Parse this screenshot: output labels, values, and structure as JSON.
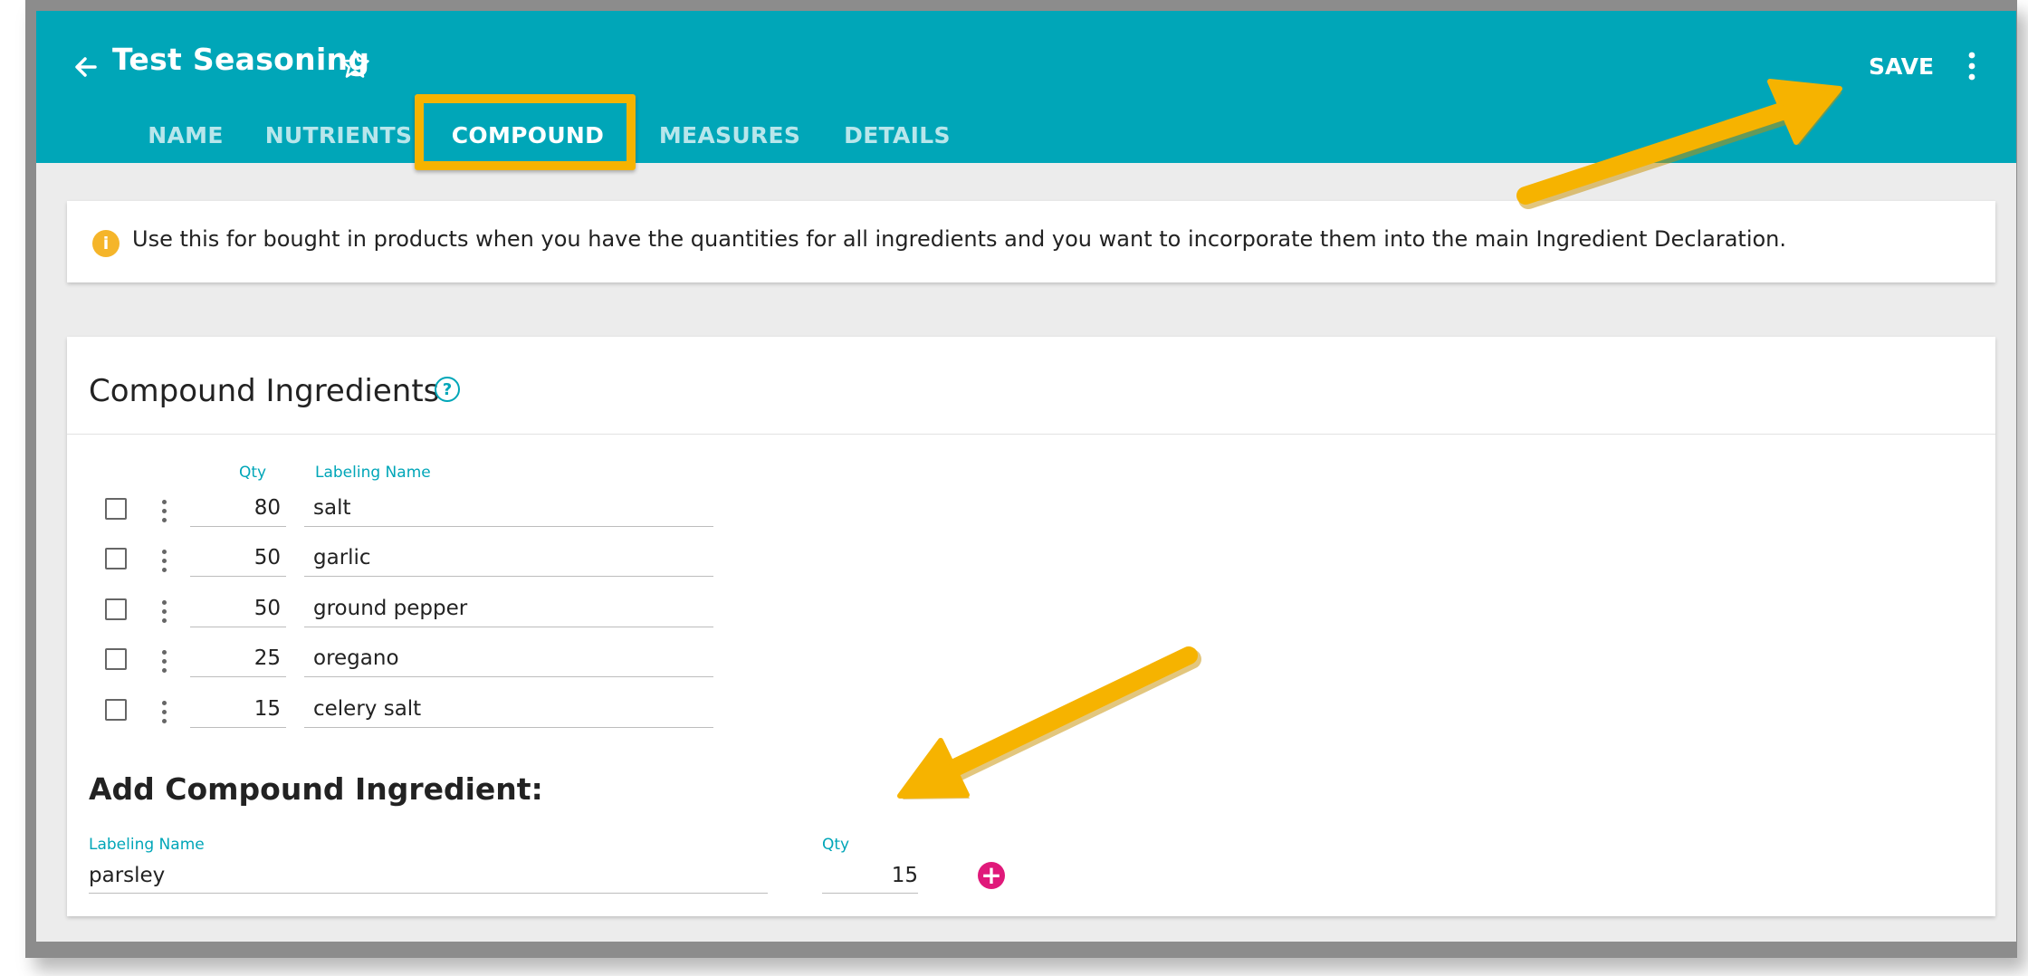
{
  "app": {
    "title": "Test Seasoning",
    "save_label": "SAVE",
    "icons": {
      "back": "arrow-left-icon",
      "favorite": "star-outline-icon",
      "more": "more-vert-icon"
    }
  },
  "tabs": [
    {
      "label": "NAME",
      "active": false
    },
    {
      "label": "NUTRIENTS",
      "active": false
    },
    {
      "label": "COMPOUND",
      "active": true
    },
    {
      "label": "MEASURES",
      "active": false
    },
    {
      "label": "DETAILS",
      "active": false
    }
  ],
  "info": {
    "icon": "info-icon",
    "text": "Use this for bought in products when you have the quantities for all ingredients and you want to incorporate them into the main Ingredient Declaration."
  },
  "compound": {
    "title": "Compound Ingredients",
    "help_icon": "help-circle-icon",
    "columns": {
      "qty": "Qty",
      "name": "Labeling Name"
    },
    "rows": [
      {
        "qty": "80",
        "name": "salt"
      },
      {
        "qty": "50",
        "name": "garlic"
      },
      {
        "qty": "50",
        "name": "ground pepper"
      },
      {
        "qty": "25",
        "name": "oregano"
      },
      {
        "qty": "15",
        "name": "celery salt"
      }
    ]
  },
  "add": {
    "title": "Add Compound Ingredient:",
    "name_label": "Labeling Name",
    "name_value": "parsley",
    "qty_label": "Qty",
    "qty_value": "15",
    "add_icon": "plus-circle-icon"
  },
  "colors": {
    "primary": "#00a6b8",
    "background": "#ececec",
    "accent_pink": "#e0197a",
    "info_yellow": "#f5b52a",
    "annotation_yellow": "#f6b300"
  }
}
